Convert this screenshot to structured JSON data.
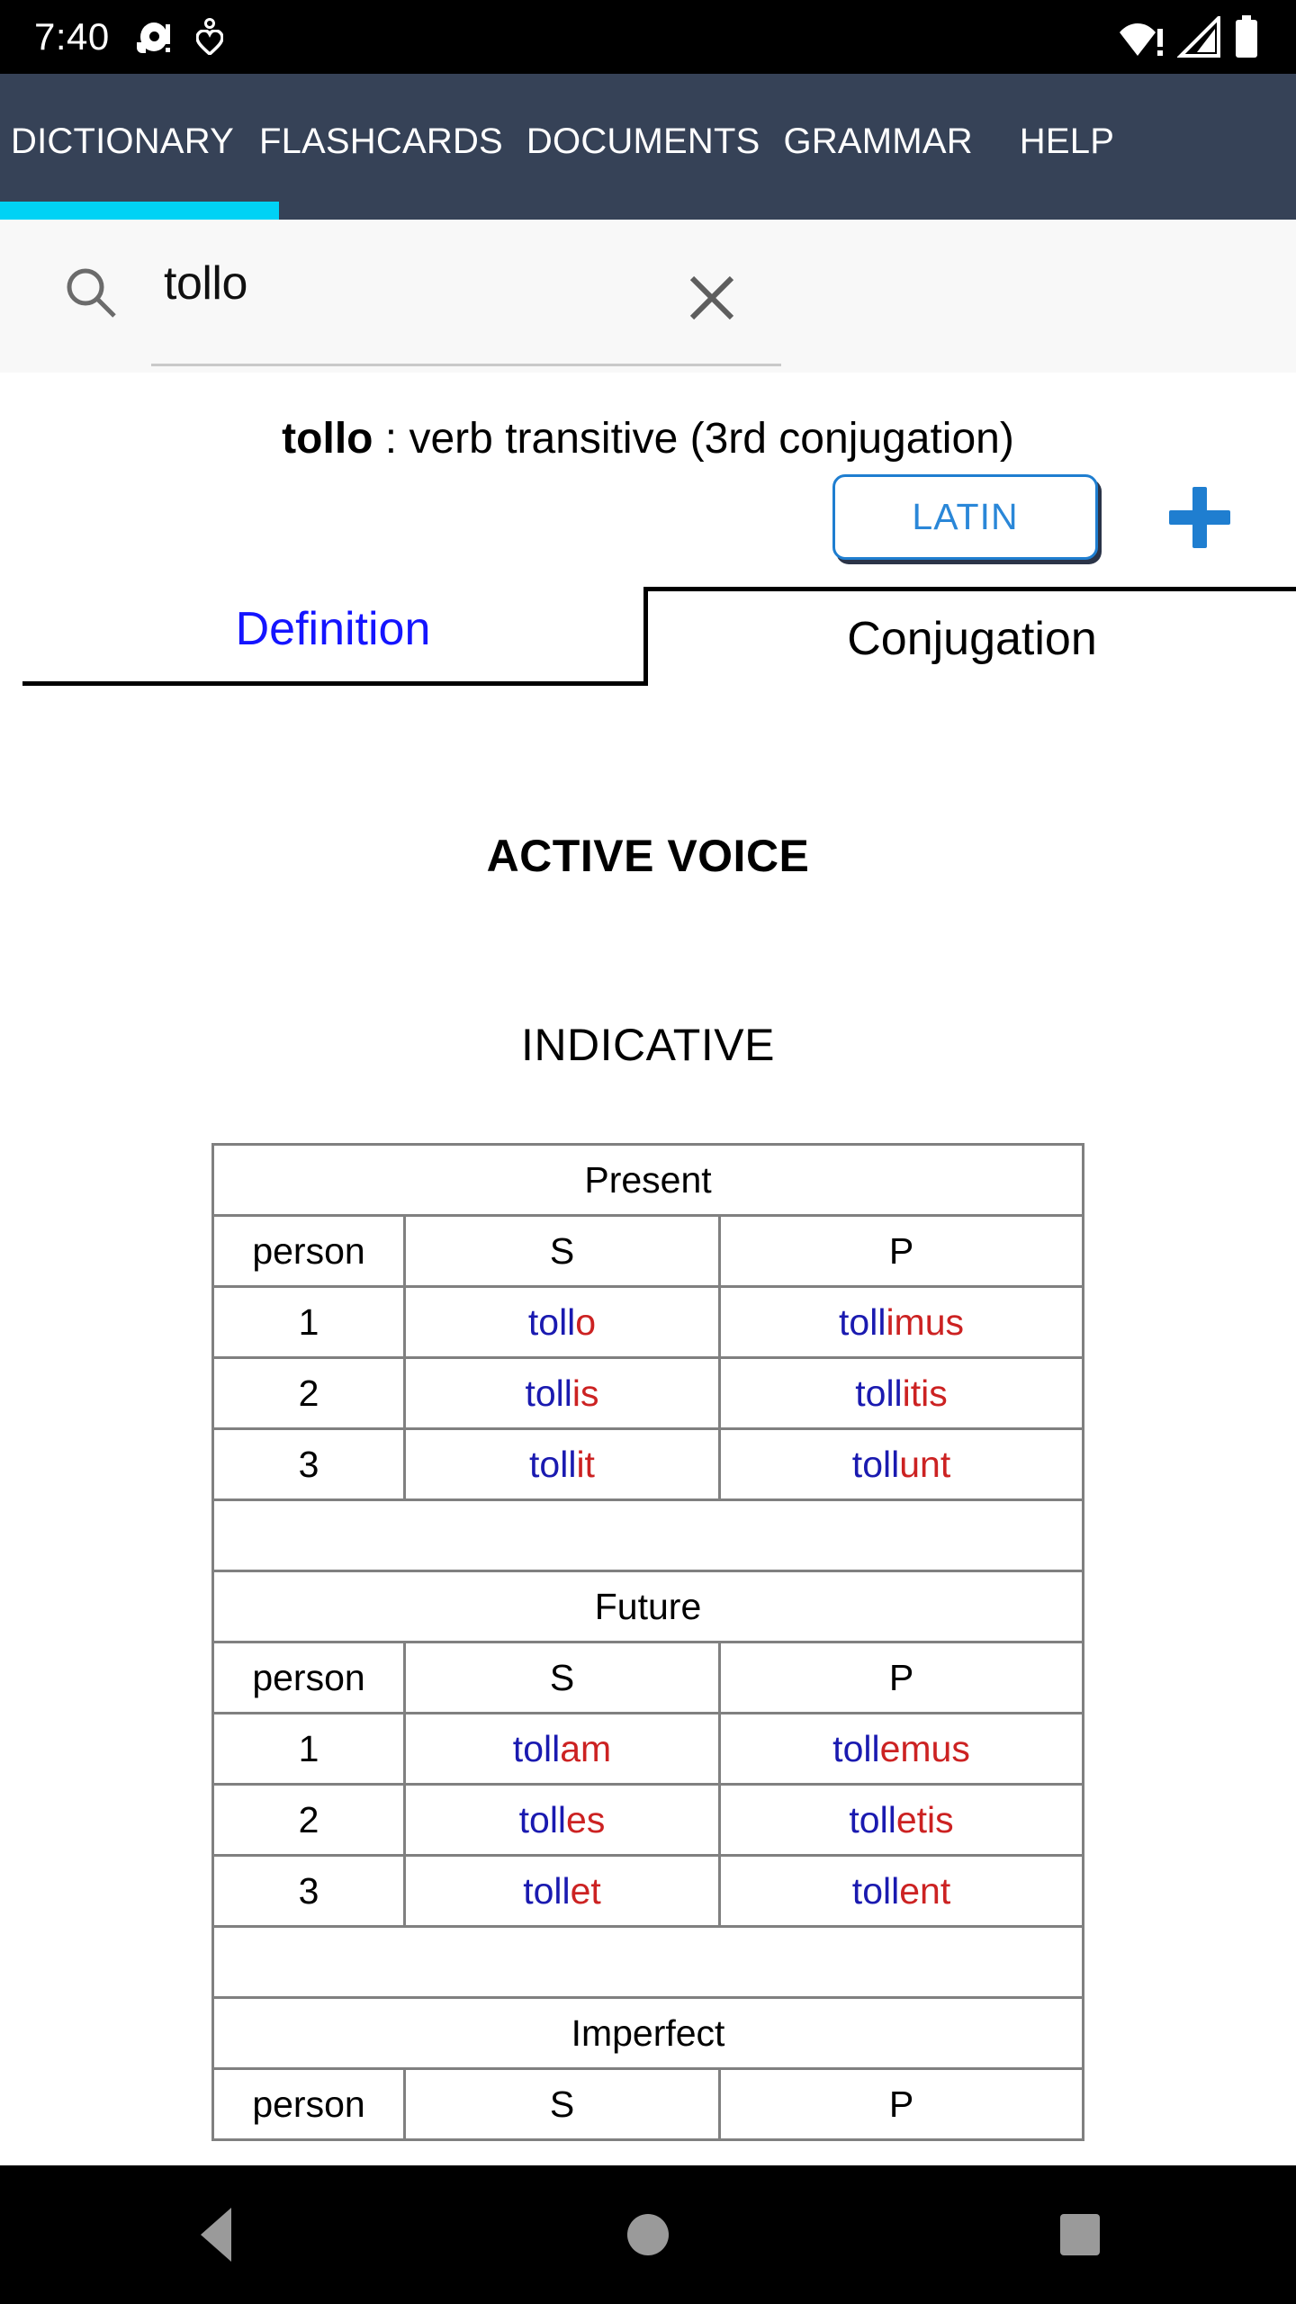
{
  "status_bar": {
    "time": "7:40",
    "icons": [
      "camera-dot-icon",
      "heart-location-icon",
      "wifi-warning-icon",
      "signal-icon",
      "battery-icon"
    ]
  },
  "app_bar": {
    "tabs": [
      {
        "label": "DICTIONARY",
        "active": true
      },
      {
        "label": "FLASHCARDS",
        "active": false
      },
      {
        "label": "DOCUMENTS",
        "active": false
      },
      {
        "label": "GRAMMAR",
        "active": false
      },
      {
        "label": "HELP",
        "active": false
      }
    ],
    "indicator_color": "#00d2f5",
    "background_color": "#364257"
  },
  "search": {
    "value": "tollo",
    "placeholder": "",
    "search_icon": "search-icon",
    "clear_icon": "close-icon",
    "language_button": "LATIN",
    "add_icon": "plus-icon",
    "accent_color": "#1f7ed0"
  },
  "headword": {
    "word": "tollo",
    "separator": " : ",
    "part_of_speech": "verb transitive (3rd conjugation)"
  },
  "entry_tabs": [
    {
      "label": "Definition",
      "active": false,
      "color": "#1414ff"
    },
    {
      "label": "Conjugation",
      "active": true,
      "color": "#000000"
    }
  ],
  "conjugation": {
    "voice": "ACTIVE VOICE",
    "mood": "INDICATIVE",
    "column_headers": [
      "person",
      "S",
      "P"
    ],
    "stem_color": "#1a1ab0",
    "ending_color": "#cc2222",
    "tenses": [
      {
        "name": "Present",
        "rows": [
          {
            "person": "1",
            "s_stem": "toll",
            "s_end": "o",
            "p_stem": "toll",
            "p_end": "imus"
          },
          {
            "person": "2",
            "s_stem": "toll",
            "s_end": "is",
            "p_stem": "toll",
            "p_end": "itis"
          },
          {
            "person": "3",
            "s_stem": "toll",
            "s_end": "it",
            "p_stem": "toll",
            "p_end": "unt"
          }
        ]
      },
      {
        "name": "Future",
        "rows": [
          {
            "person": "1",
            "s_stem": "toll",
            "s_end": "am",
            "p_stem": "toll",
            "p_end": "emus"
          },
          {
            "person": "2",
            "s_stem": "toll",
            "s_end": "es",
            "p_stem": "toll",
            "p_end": "etis"
          },
          {
            "person": "3",
            "s_stem": "toll",
            "s_end": "et",
            "p_stem": "toll",
            "p_end": "ent"
          }
        ]
      },
      {
        "name": "Imperfect",
        "rows": []
      }
    ]
  },
  "nav_bar": {
    "back": "back-icon",
    "home": "home-icon",
    "recents": "recents-icon"
  }
}
